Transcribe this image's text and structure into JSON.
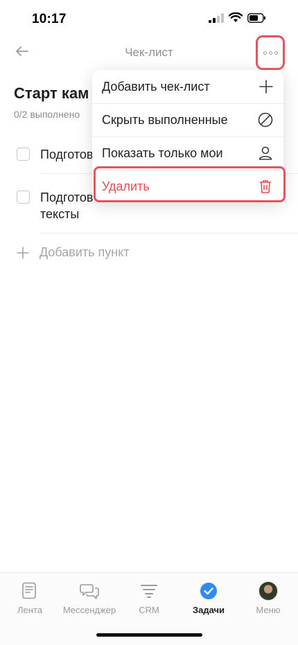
{
  "status_bar": {
    "time": "10:17"
  },
  "header": {
    "title": "Чек-лист"
  },
  "checklist": {
    "title": "Старт кам",
    "progress": "0/2 выполнено",
    "items": [
      {
        "text": "Подготов"
      },
      {
        "text": "Подготов\nтексты"
      }
    ],
    "add_item_label": "Добавить пункт"
  },
  "menu": {
    "items": [
      {
        "label": "Добавить чек-лист",
        "icon": "plus-icon"
      },
      {
        "label": "Скрыть выполненные",
        "icon": "hide-icon"
      },
      {
        "label": "Показать только мои",
        "icon": "user-icon"
      },
      {
        "label": "Удалить",
        "icon": "trash-icon",
        "color": "#e94c4f"
      }
    ]
  },
  "tabbar": {
    "tabs": [
      {
        "label": "Лента",
        "icon": "feed-icon"
      },
      {
        "label": "Мессенджер",
        "icon": "messenger-icon"
      },
      {
        "label": "CRM",
        "icon": "crm-icon"
      },
      {
        "label": "Задачи",
        "icon": "tasks-icon",
        "active": true
      },
      {
        "label": "Меню",
        "icon": "avatar"
      }
    ]
  },
  "colors": {
    "accent": "#2f8af5",
    "danger": "#e94c4f",
    "highlight": "#e2555c"
  }
}
